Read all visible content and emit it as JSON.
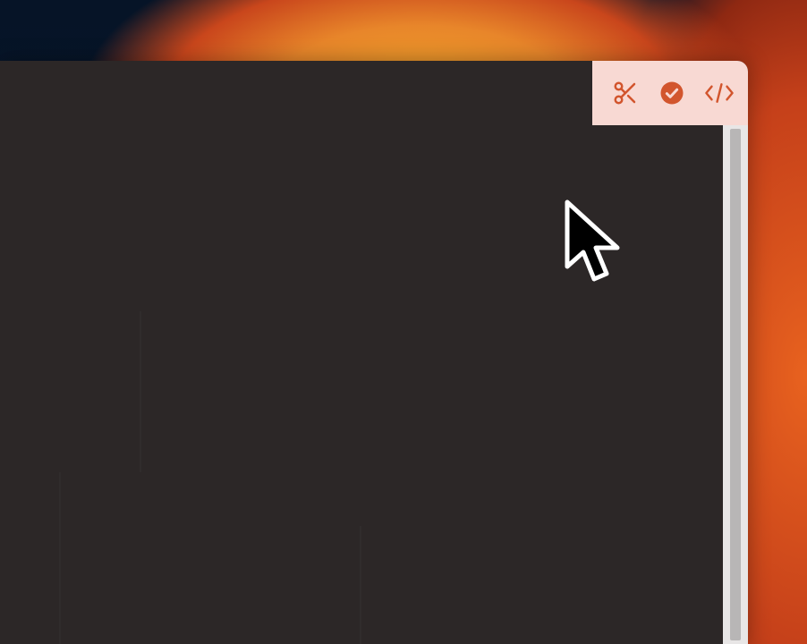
{
  "desktop": {
    "wallpaper": "orange-swirl-on-dark-navy"
  },
  "window": {
    "background_color": "#2c2727",
    "toolbar": {
      "background_color": "#f8d9d3",
      "accent_color": "#d2552d",
      "buttons": [
        {
          "icon": "scissors-icon"
        },
        {
          "icon": "check-circle-icon"
        },
        {
          "icon": "code-icon"
        }
      ]
    }
  },
  "cursor": {
    "icon": "arrow-pointer"
  }
}
